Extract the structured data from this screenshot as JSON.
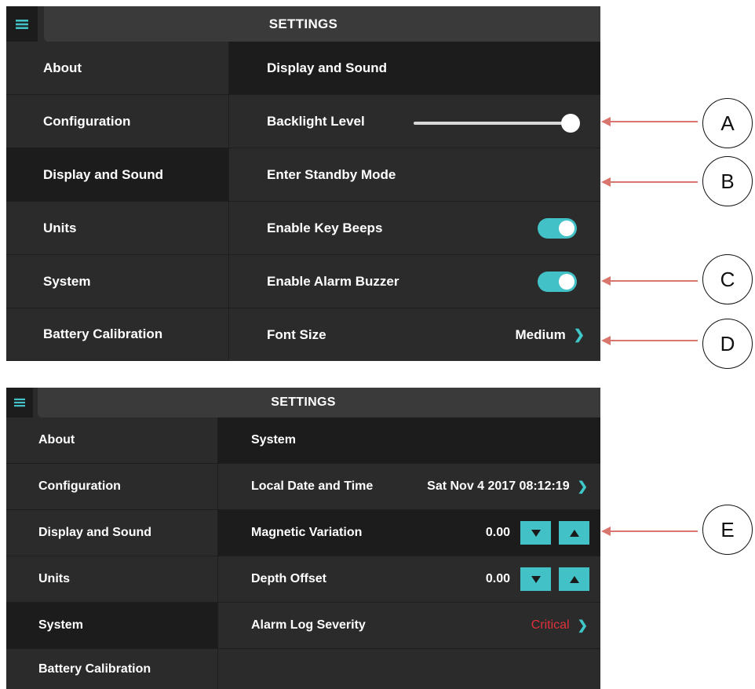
{
  "screen1": {
    "title": "SETTINGS",
    "nav": [
      "About",
      "Configuration",
      "Display and Sound",
      "Units",
      "System",
      "Battery Calibration"
    ],
    "section_title": "Display and Sound",
    "rows": {
      "backlight": "Backlight Level",
      "standby": "Enter Standby Mode",
      "key_beeps": "Enable Key Beeps",
      "alarm_buzzer": "Enable Alarm Buzzer",
      "font_size": "Font Size",
      "font_size_value": "Medium"
    },
    "backlight_level": 1.0,
    "key_beeps_on": true,
    "alarm_buzzer_on": true
  },
  "screen2": {
    "title": "SETTINGS",
    "nav": [
      "About",
      "Configuration",
      "Display and Sound",
      "Units",
      "System",
      "Battery Calibration"
    ],
    "section_title": "System",
    "rows": {
      "datetime": "Local Date and Time",
      "datetime_value": "Sat Nov 4 2017 08:12:19",
      "mag_var": "Magnetic Variation",
      "mag_var_value": "0.00",
      "depth_offset": "Depth Offset",
      "depth_offset_value": "0.00",
      "alarm_log": "Alarm Log Severity",
      "alarm_log_value": "Critical"
    }
  },
  "callouts": [
    "A",
    "B",
    "C",
    "D",
    "E"
  ],
  "colors": {
    "accent": "#42c2c7",
    "critical": "#e0303a",
    "arrow": "#d9776f",
    "panel": "#2b2b2b",
    "selected": "#1c1c1c"
  },
  "icons": {
    "menu": "hamburger-icon",
    "chevron": "chevron-right-icon",
    "down": "triangle-down-icon",
    "up": "triangle-up-icon"
  }
}
